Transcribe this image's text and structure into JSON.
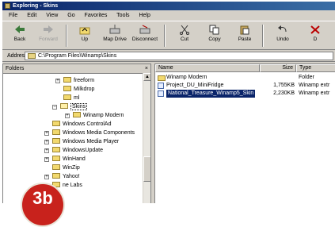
{
  "window": {
    "title": "Exploring - Skins"
  },
  "menu": [
    "File",
    "Edit",
    "View",
    "Go",
    "Favorites",
    "Tools",
    "Help"
  ],
  "toolbar": [
    {
      "label": "Back",
      "icon": "back-arrow-icon",
      "enabled": true
    },
    {
      "label": "Forward",
      "icon": "forward-arrow-icon",
      "enabled": false
    },
    {
      "label": "Up",
      "icon": "up-folder-icon",
      "enabled": true
    },
    {
      "label": "Map Drive",
      "icon": "map-drive-icon",
      "enabled": true
    },
    {
      "label": "Disconnect",
      "icon": "disconnect-icon",
      "enabled": true
    },
    {
      "label": "Cut",
      "icon": "scissors-icon",
      "enabled": true
    },
    {
      "label": "Copy",
      "icon": "copy-icon",
      "enabled": true
    },
    {
      "label": "Paste",
      "icon": "paste-icon",
      "enabled": true
    },
    {
      "label": "Undo",
      "icon": "undo-icon",
      "enabled": true
    },
    {
      "label": "D",
      "icon": "delete-icon",
      "enabled": true
    }
  ],
  "address": {
    "label": "Address",
    "value": "C:\\Program Files\\Winamp\\Skins"
  },
  "folders_pane": {
    "title": "Folders",
    "close": "×"
  },
  "tree": [
    {
      "label": "freeform",
      "expander": "+"
    },
    {
      "label": "Milkdrop",
      "expander": ""
    },
    {
      "label": "ml",
      "expander": ""
    },
    {
      "label": "Skins",
      "expander": "−"
    },
    {
      "label": "Winamp Modern",
      "expander": "+"
    },
    {
      "label": "Windows ControlAd",
      "expander": ""
    },
    {
      "label": "Windows Media Components",
      "expander": "+"
    },
    {
      "label": "Windows Media Player",
      "expander": "+"
    },
    {
      "label": "WindowsUpdate",
      "expander": "+"
    },
    {
      "label": "WinHand",
      "expander": "+"
    },
    {
      "label": "WinZip",
      "expander": ""
    },
    {
      "label": "Yahoo!",
      "expander": "+"
    },
    {
      "label": "ne Labs",
      "expander": ""
    }
  ],
  "columns": {
    "name": "Name",
    "size": "Size",
    "type": "Type"
  },
  "files": [
    {
      "name": "Winamp Modern",
      "size": "",
      "type": "Folder",
      "selected": false
    },
    {
      "name": "Project_DU_MiniFridge",
      "size": "1,755KB",
      "type": "Winamp extr",
      "selected": false
    },
    {
      "name": "National_Treasure_Winamp5_Skin",
      "size": "2,230KB",
      "type": "Winamp extr",
      "selected": true
    }
  ],
  "badge": {
    "text": "3b",
    "color": "#c8221c"
  },
  "colors": {
    "titlebar": "#0a246a",
    "selection": "#0a246a",
    "chrome": "#d4d0c8"
  }
}
